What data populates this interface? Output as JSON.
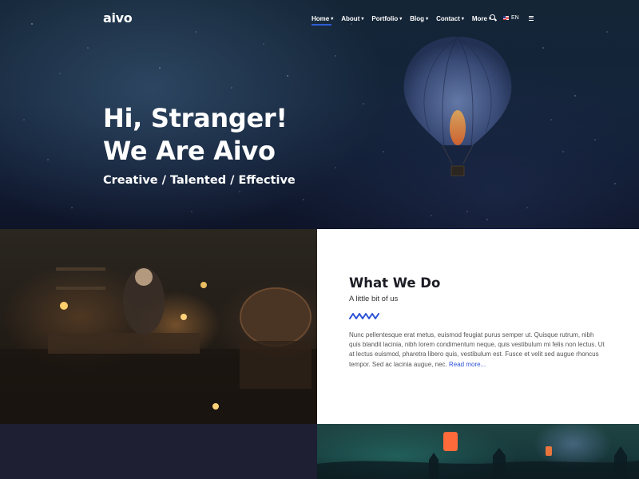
{
  "brand": {
    "logo": "aivo"
  },
  "nav": {
    "items": [
      {
        "label": "Home",
        "active": true
      },
      {
        "label": "About",
        "active": false
      },
      {
        "label": "Portfolio",
        "active": false
      },
      {
        "label": "Blog",
        "active": false
      },
      {
        "label": "Contact",
        "active": false
      },
      {
        "label": "More",
        "active": false
      }
    ],
    "language": "EN",
    "icons": [
      "search-icon",
      "uk-flag-icon",
      "hamburger-icon",
      "chevron-down-icon"
    ]
  },
  "hero": {
    "title_line1": "Hi, Stranger!",
    "title_line2": "We Are Aivo",
    "tagline": "Creative / Talented / Effective"
  },
  "what_we_do": {
    "title": "What We Do",
    "subtitle": "A little bit of us",
    "body": "Nunc pellentesque erat metus, euismod feugiat purus semper ut. Quisque rutrum, nibh quis blandit lacinia, nibh lorem condimentum neque, quis vestibulum mi felis non lectus. Ut at lectus euismod, pharetra libero quis, vestibulum est. Fusce et velit sed augue rhoncus tempor. Sed ac lacinia augue, nec.",
    "read_more": "Read more..."
  },
  "colors": {
    "accent": "#2b52d6",
    "hero_bg": "#14243a",
    "panel_bg": "#ffffff",
    "dark_block": "#1e1f33"
  }
}
